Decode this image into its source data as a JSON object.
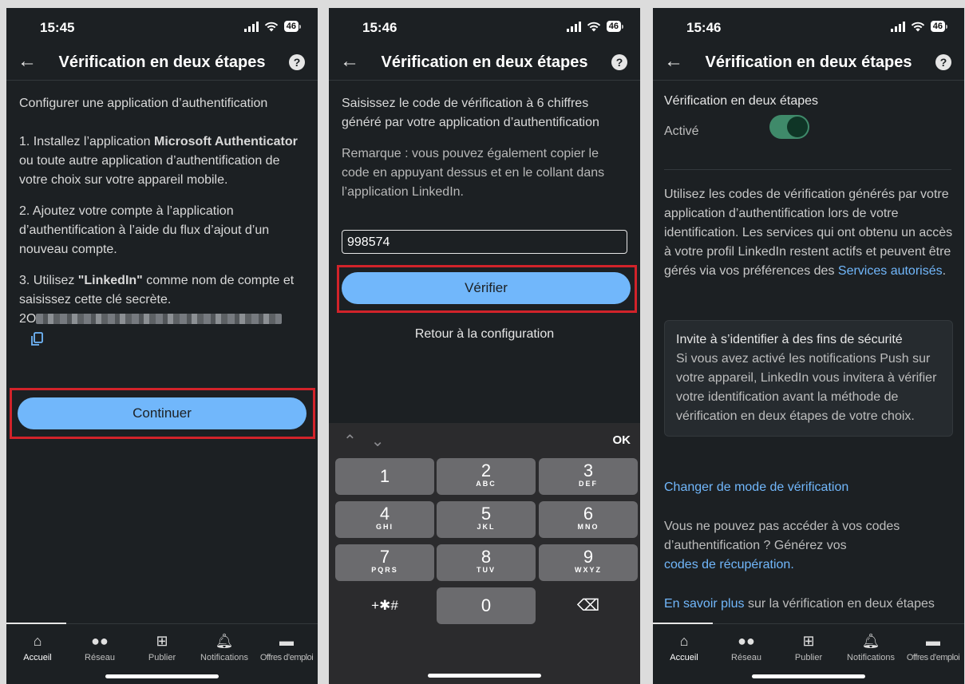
{
  "screen1": {
    "time": "15:45",
    "battery": "46",
    "title": "Vérification en deux étapes",
    "heading": "Configurer une application d’authentification",
    "step1_a": "1. Installez l’application ",
    "step1_b": "Microsoft Authenticator",
    "step1_c": " ou toute autre application d’authentification de votre choix sur votre appareil mobile.",
    "step2": "2. Ajoutez votre compte à l’application d’authentification à l’aide du flux d’ajout d’un nouveau compte.",
    "step3_a": "3. Utilisez ",
    "step3_b": "\"LinkedIn\"",
    "step3_c": " comme nom de compte et saisissez cette clé secrète.",
    "key_prefix": "2O",
    "continue_label": "Continuer"
  },
  "screen2": {
    "time": "15:46",
    "battery": "46",
    "title": "Vérification en deux étapes",
    "instruction": "Saisissez le code de vérification à 6 chiffres généré par votre application d’authentification",
    "note": "Remarque : vous pouvez également copier le code en appuyant dessus et en le collant dans l’application LinkedIn.",
    "code_value": "998574",
    "verify_label": "Vérifier",
    "back_to_config": "Retour à la configuration",
    "keyboard": {
      "ok": "OK",
      "keys": [
        {
          "n": "1",
          "l": ""
        },
        {
          "n": "2",
          "l": "ABC"
        },
        {
          "n": "3",
          "l": "DEF"
        },
        {
          "n": "4",
          "l": "GHI"
        },
        {
          "n": "5",
          "l": "JKL"
        },
        {
          "n": "6",
          "l": "MNO"
        },
        {
          "n": "7",
          "l": "PQRS"
        },
        {
          "n": "8",
          "l": "TUV"
        },
        {
          "n": "9",
          "l": "WXYZ"
        },
        {
          "n": "+✱#",
          "l": ""
        },
        {
          "n": "0",
          "l": ""
        },
        {
          "n": "⌫",
          "l": ""
        }
      ]
    }
  },
  "screen3": {
    "time": "15:46",
    "battery": "46",
    "title": "Vérification en deux étapes",
    "section_title": "Vérification en deux étapes",
    "status": "Activé",
    "desc_a": "Utilisez les codes de vérification générés par votre application d’authentification lors de votre identification. Les services qui ont obtenu un accès à votre profil LinkedIn restent actifs et peuvent être gérés via vos préférences des ",
    "desc_link": "Services autorisés",
    "desc_end": ".",
    "box_title": "Invite à s’identifier à des fins de sécurité",
    "box_text": "Si vous avez activé les notifications Push sur votre appareil, LinkedIn vous invitera à vérifier votre identification avant la méthode de vérification en deux étapes de votre choix.",
    "change_mode": "Changer de mode de vérification",
    "codes_text": "Vous ne pouvez pas accéder à vos codes d’authentification ? Générez vos",
    "codes_link": "codes de récupération.",
    "learn_link": "En savoir plus",
    "learn_text": " sur la vérification en deux étapes"
  },
  "nav": [
    "Accueil",
    "Réseau",
    "Publier",
    "Notifications",
    "Offres d’emploi"
  ]
}
